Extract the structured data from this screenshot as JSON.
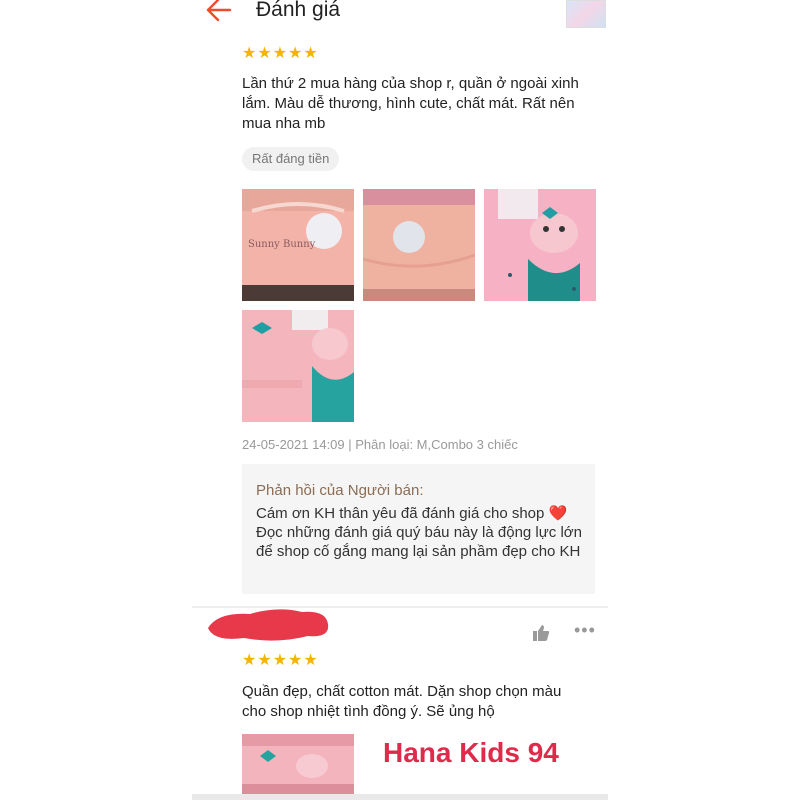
{
  "header": {
    "title": "Đánh giá",
    "back_icon": "arrow-left-icon"
  },
  "review1": {
    "rating": "★★★★★",
    "text": "Lần thứ 2 mua hàng của shop r, quần ở ngoài xinh lắm. Màu dễ thương, hình cute, chất mát. Rất nên mua nha mb",
    "tag": "Rất đáng tiền",
    "meta": "24-05-2021 14:09 | Phân loại: M,Combo 3 chiếc",
    "seller_reply": {
      "title": "Phản hồi của Người bán:",
      "text_before_heart": "Cám ơn KH thân yêu đã đánh giá cho shop ",
      "heart": "❤️",
      "text_after_heart": " Đọc những đánh giá quý báu này là động lực lớn để shop cố gắng mang lại sản phầm đẹp cho KH"
    }
  },
  "review2": {
    "rating": "★★★★★",
    "text": "Quần đẹp, chất cotton mát. Dặn shop chọn màu cho shop nhiệt tình đồng ý. Sẽ ủng hộ",
    "more": "•••",
    "watermark": "Hana Kids 94"
  },
  "colors": {
    "accent": "#ee4d2d",
    "star": "#f6b400",
    "watermark": "#e02a4b",
    "redaction": "#e8394a"
  }
}
